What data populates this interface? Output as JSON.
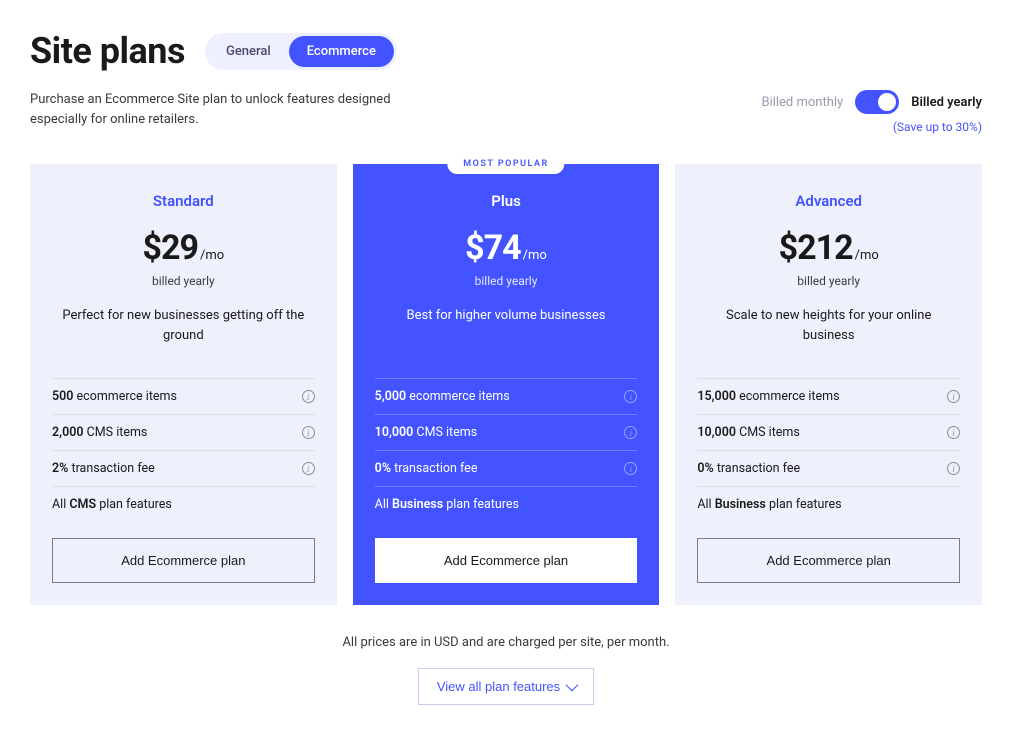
{
  "header": {
    "title": "Site plans",
    "tabs": {
      "general": "General",
      "ecommerce": "Ecommerce"
    }
  },
  "subtitle": "Purchase an Ecommerce Site plan to unlock features designed especially for online retailers.",
  "billing": {
    "monthly": "Billed monthly",
    "yearly": "Billed yearly",
    "savings": "(Save up to 30%)"
  },
  "plans": {
    "standard": {
      "name": "Standard",
      "price": "$29",
      "per": "/mo",
      "billed": "billed yearly",
      "desc": "Perfect for new businesses getting off the ground",
      "f1_bold": "500",
      "f1_rest": " ecommerce items",
      "f2_bold": "2,000",
      "f2_rest": " CMS items",
      "f3_bold": "2%",
      "f3_rest": " transaction fee",
      "f4_pre": "All ",
      "f4_bold": "CMS",
      "f4_rest": " plan features",
      "cta": "Add Ecommerce plan"
    },
    "plus": {
      "badge": "MOST POPULAR",
      "name": "Plus",
      "price": "$74",
      "per": "/mo",
      "billed": "billed yearly",
      "desc": "Best for higher volume businesses",
      "f1_bold": "5,000",
      "f1_rest": " ecommerce items",
      "f2_bold": "10,000",
      "f2_rest": " CMS items",
      "f3_bold": "0%",
      "f3_rest": " transaction fee",
      "f4_pre": "All ",
      "f4_bold": "Business",
      "f4_rest": " plan features",
      "cta": "Add Ecommerce plan"
    },
    "advanced": {
      "name": "Advanced",
      "price": "$212",
      "per": "/mo",
      "billed": "billed yearly",
      "desc": "Scale to new heights for your online business",
      "f1_bold": "15,000",
      "f1_rest": " ecommerce items",
      "f2_bold": "10,000",
      "f2_rest": " CMS items",
      "f3_bold": "0%",
      "f3_rest": " transaction fee",
      "f4_pre": "All ",
      "f4_bold": "Business",
      "f4_rest": " plan features",
      "cta": "Add Ecommerce plan"
    }
  },
  "footer": {
    "note": "All prices are in USD and are charged per site, per month.",
    "view_all": "View all plan features"
  }
}
